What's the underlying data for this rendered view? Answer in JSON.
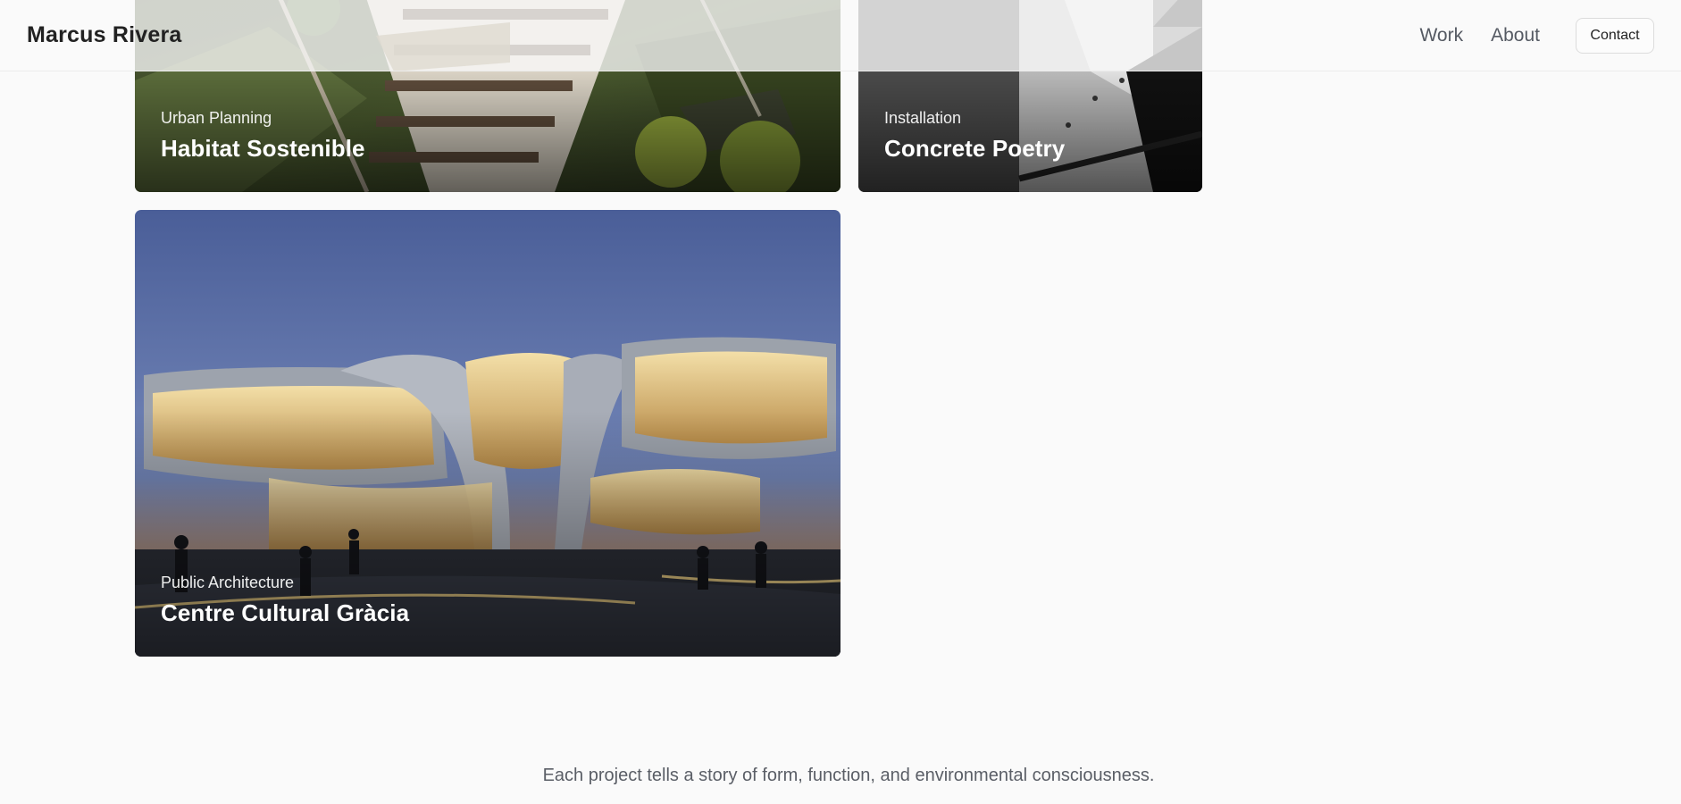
{
  "header": {
    "brand": "Marcus Rivera",
    "nav": {
      "work": "Work",
      "about": "About",
      "contact": "Contact"
    }
  },
  "projects": [
    {
      "category": "Urban Planning",
      "title": "Habitat Sostenible"
    },
    {
      "category": "Installation",
      "title": "Concrete Poetry"
    },
    {
      "category": "Public Architecture",
      "title": "Centre Cultural Gràcia"
    }
  ],
  "footer": {
    "tagline": "Each project tells a story of form, function, and environmental consciousness."
  }
}
